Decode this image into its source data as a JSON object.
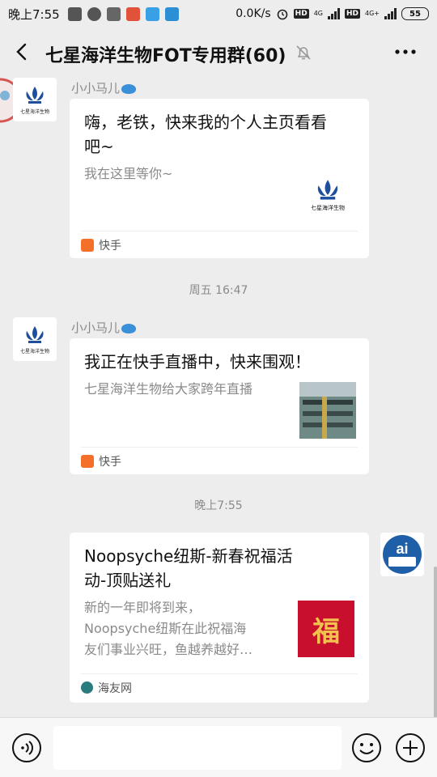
{
  "status_bar": {
    "time": "晚上7:55",
    "speed": "0.0K/s",
    "hd1": "HD",
    "net1": "4G",
    "hd2": "HD",
    "net2": "4G+",
    "battery": "55"
  },
  "header": {
    "title": "七星海洋生物FOT专用群(60)"
  },
  "chat": {
    "avatar_caption": "七星海洋生物",
    "messages": [
      {
        "sender": "小小马儿",
        "title": "嗨，老铁，快来我的个人主页看看吧~",
        "title_line1": "嗨，老铁，快来我的个人主页看看",
        "title_line2": "吧~",
        "desc": "我在这里等你~",
        "source": "快手"
      },
      {
        "timestamp": "周五 16:47"
      },
      {
        "sender": "小小马儿",
        "title": "我正在快手直播中，快来围观！",
        "desc": "七星海洋生物给大家跨年直播",
        "source": "快手"
      },
      {
        "timestamp": "晚上7:55"
      },
      {
        "title_line1": "Noopsyche纽斯-新春祝福活",
        "title_line2": "动-顶贴送礼",
        "desc_line1": "新的一年即将到来，",
        "desc_line2": "Noopsyche纽斯在此祝福海",
        "desc_line3": "友们事业兴旺，鱼越养越好…",
        "source": "海友网",
        "thumb_char": "福"
      }
    ]
  },
  "colors": {
    "background": "#ededed",
    "kuaishou": "#f4702a",
    "haiyou": "#2a7c7f",
    "fu_red": "#c8102e"
  },
  "icons": [
    "back-arrow-icon",
    "mute-bell-icon",
    "more-dots-icon",
    "voice-icon",
    "emoji-icon",
    "plus-icon",
    "kuaishou-icon",
    "haiyou-icon"
  ]
}
